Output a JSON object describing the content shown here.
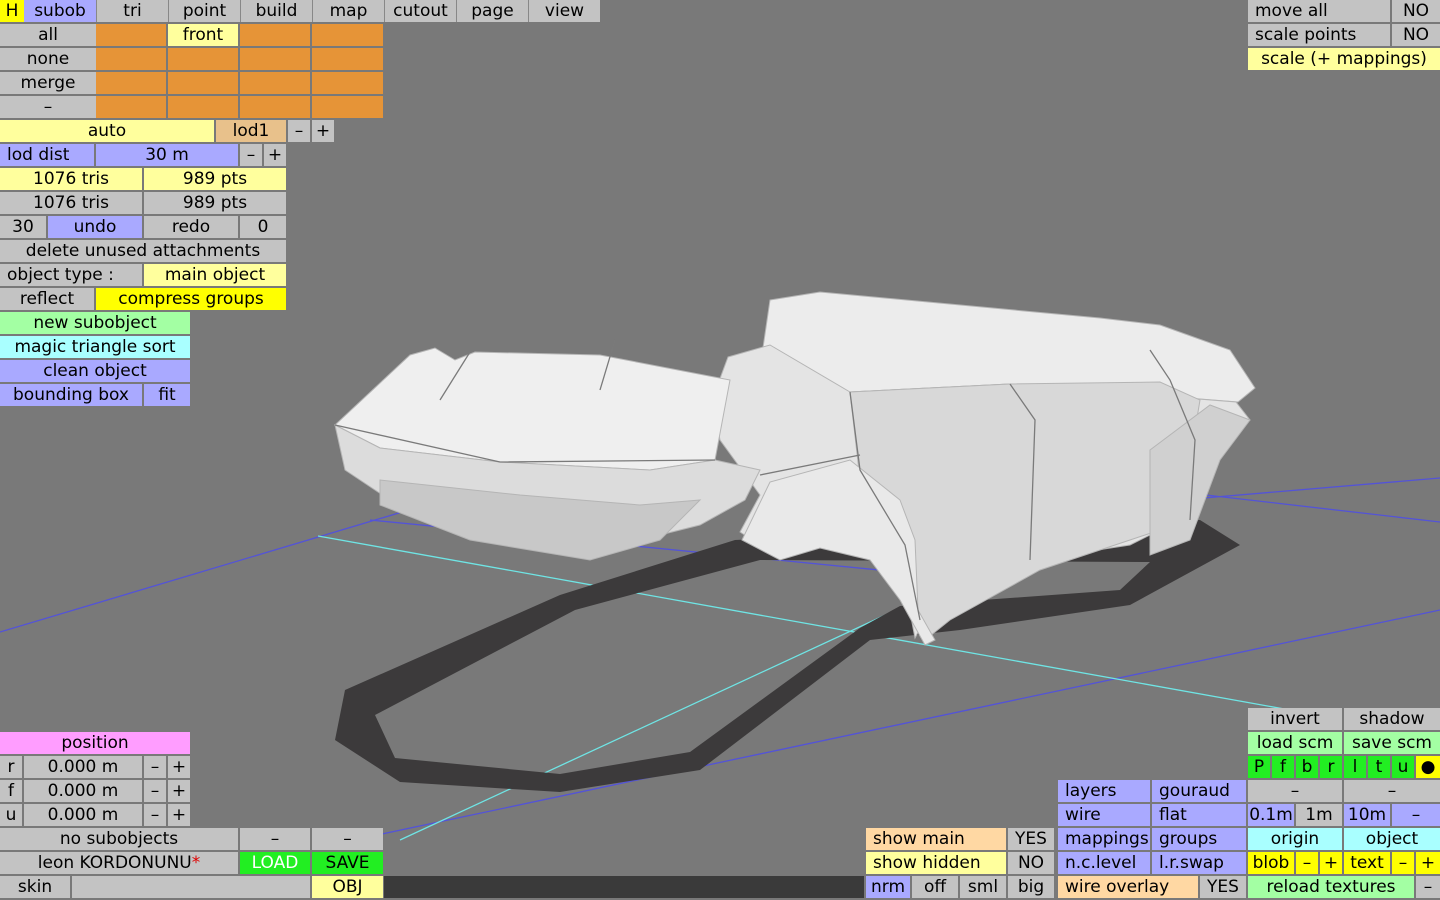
{
  "menu": {
    "h": "H",
    "subob": "subob",
    "tri": "tri",
    "point": "point",
    "build": "build",
    "map": "map",
    "cutout": "cutout",
    "page": "page",
    "view": "view"
  },
  "sel_panel": {
    "all": "all",
    "none": "none",
    "merge": "merge",
    "dash": "–",
    "front": "front"
  },
  "lod": {
    "auto": "auto",
    "lod1": "lod1",
    "minus": "–",
    "plus": "+",
    "dist_label": "lod dist",
    "dist_value": "30 m"
  },
  "stats": {
    "tris_a": "1076 tris",
    "pts_a": "989 pts",
    "tris_b": "1076 tris",
    "pts_b": "989 pts"
  },
  "undo": {
    "count": "30",
    "undo": "undo",
    "redo": "redo",
    "redo_count": "0"
  },
  "actions": {
    "delete_unused": "delete unused attachments",
    "object_type_label": "object type :",
    "object_type_value": "main object",
    "reflect": "reflect",
    "compress_groups": "compress groups",
    "new_subobject": "new subobject",
    "magic_sort": "magic triangle sort",
    "clean_object": "clean object",
    "bounding_box": "bounding box",
    "fit": "fit"
  },
  "top_right": {
    "move_all": "move all",
    "move_all_val": "NO",
    "scale_points": "scale points",
    "scale_points_val": "NO",
    "scale_mappings": "scale (+ mappings)"
  },
  "position": {
    "title": "position",
    "rows": [
      {
        "axis": "r",
        "value": "0.000 m"
      },
      {
        "axis": "f",
        "value": "0.000 m"
      },
      {
        "axis": "u",
        "value": "0.000 m"
      }
    ],
    "minus": "–",
    "plus": "+"
  },
  "bottom_left": {
    "no_subobjects": "no subobjects",
    "dash": "–",
    "object_name": "leon KORDONUNU",
    "modified_mark": "*",
    "load": "LOAD",
    "save": "SAVE",
    "skin": "skin",
    "obj": "OBJ"
  },
  "bottom_mid": {
    "show_main": "show main",
    "show_main_val": "YES",
    "show_hidden": "show hidden",
    "show_hidden_val": "NO",
    "nrm": "nrm",
    "off": "off",
    "sml": "sml",
    "big": "big"
  },
  "bottom_right": {
    "invert": "invert",
    "shadow": "shadow",
    "load_scm": "load scm",
    "save_scm": "save scm",
    "views": [
      "P",
      "f",
      "b",
      "r",
      "l",
      "t",
      "u",
      "●"
    ],
    "dash": "–",
    "layers": "layers",
    "gouraud": "gouraud",
    "wire": "wire",
    "flat": "flat",
    "mappings": "mappings",
    "groups": "groups",
    "nc_level": "n.c.level",
    "lr_swap": "l.r.swap",
    "wire_overlay": "wire overlay",
    "wire_overlay_val": "YES",
    "grid_01": "0.1m",
    "grid_1": "1m",
    "grid_10": "10m",
    "origin": "origin",
    "object": "object",
    "blob": "blob",
    "text": "text",
    "minus": "–",
    "plus": "+",
    "reload_textures": "reload textures"
  }
}
